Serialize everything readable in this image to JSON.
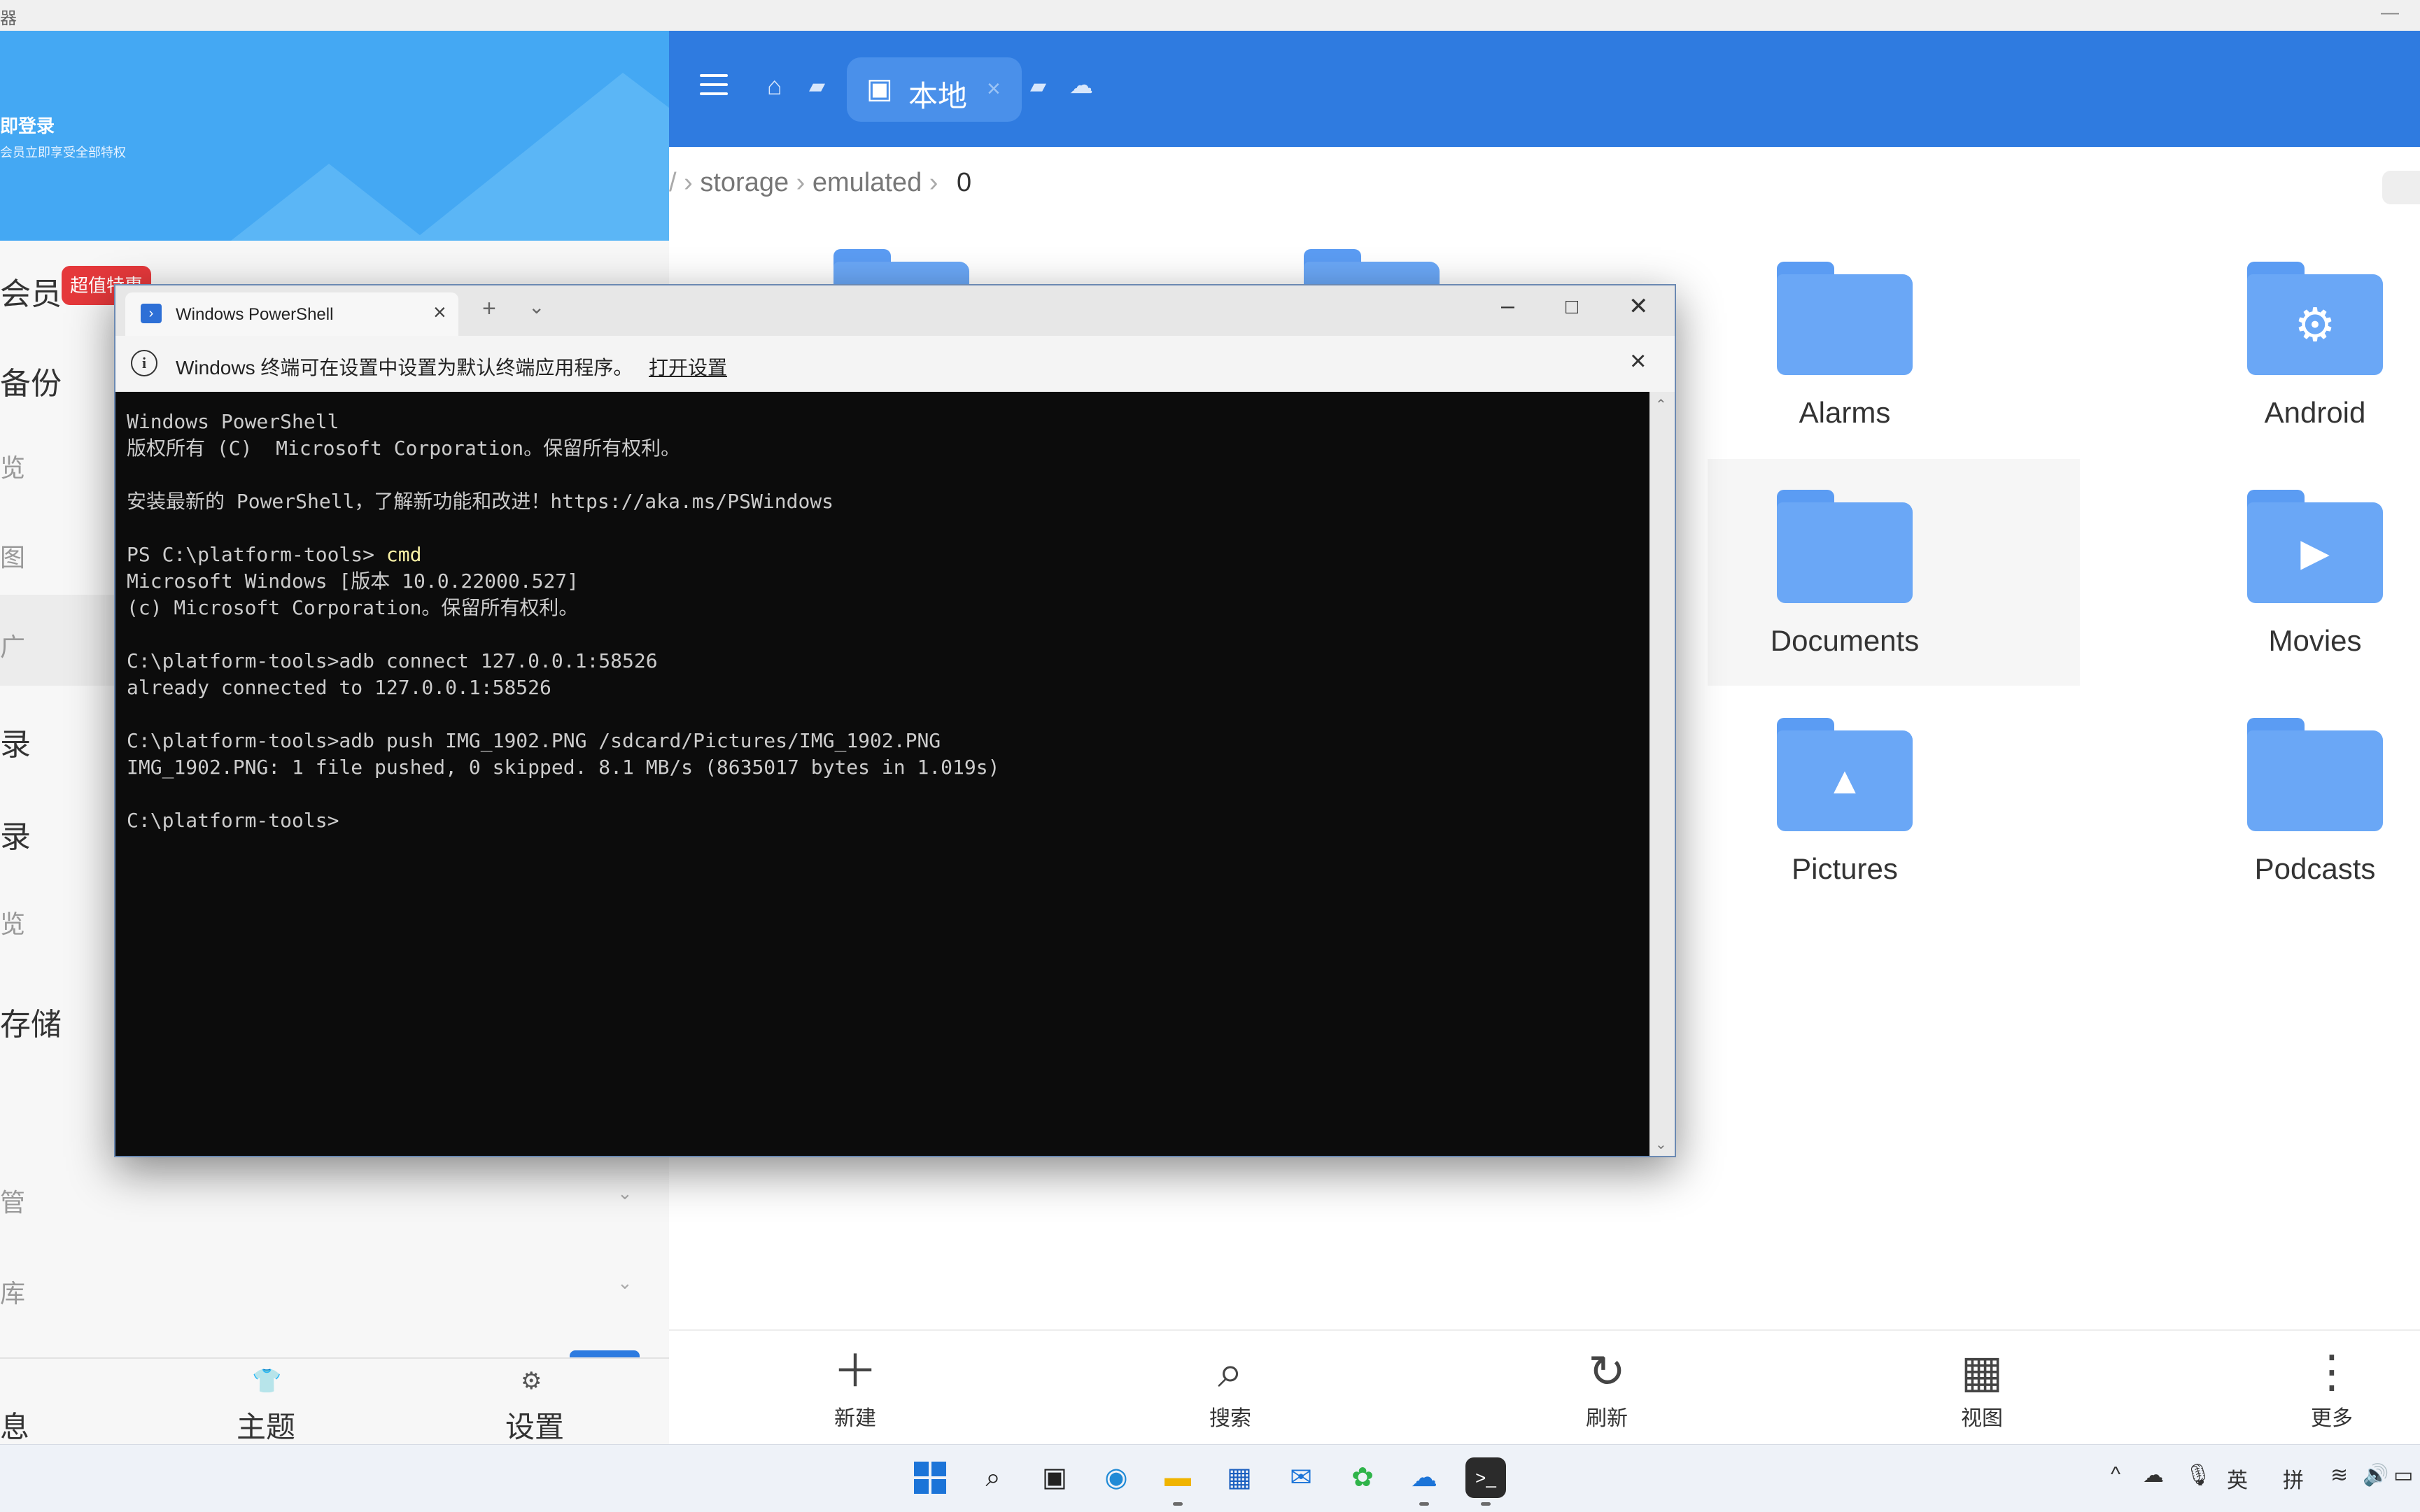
{
  "topbar": {
    "title": "器",
    "min": "—"
  },
  "drawer": {
    "login_title": "即登录",
    "login_sub": "会员立即享受全部特权",
    "items": [
      "会员",
      "备份",
      "览",
      "图",
      "广",
      "录",
      "录",
      "览",
      "存储",
      "管",
      "库"
    ],
    "vip_badge": "超值特惠",
    "bottom": {
      "msg": "息",
      "theme": "主题",
      "settings": "设置",
      "theme_icon": "shirt-icon",
      "settings_icon": "gear-icon"
    }
  },
  "appbar": {
    "tab_label": "本地",
    "tab_close": "×"
  },
  "breadcrumb": {
    "root": "/",
    "items": [
      "storage",
      "emulated",
      "0"
    ]
  },
  "folders": [
    {
      "name": "Alarms",
      "glyph": ""
    },
    {
      "name": "Android",
      "glyph": "⚙"
    },
    {
      "name": "Documents",
      "glyph": ""
    },
    {
      "name": "Movies",
      "glyph": "▶"
    },
    {
      "name": "Pictures",
      "glyph": "▲"
    },
    {
      "name": "Podcasts",
      "glyph": ""
    }
  ],
  "toolbar": [
    {
      "label": "新建",
      "icon": "plus-icon",
      "glyph": "＋"
    },
    {
      "label": "搜索",
      "icon": "search-icon",
      "glyph": "⌕"
    },
    {
      "label": "刷新",
      "icon": "refresh-icon",
      "glyph": "↻"
    },
    {
      "label": "视图",
      "icon": "grid-icon",
      "glyph": "▦"
    },
    {
      "label": "更多",
      "icon": "more-icon",
      "glyph": "⋮"
    }
  ],
  "powershell": {
    "tab_title": "Windows PowerShell",
    "info_msg": "Windows 终端可在设置中设置为默认终端应用程序。",
    "info_link": "打开设置",
    "lines": [
      "Windows PowerShell",
      "版权所有 (C)  Microsoft Corporation。保留所有权利。",
      "",
      "安装最新的 PowerShell，了解新功能和改进！https://aka.ms/PSWindows",
      "",
      "PS C:\\platform-tools> ",
      "Microsoft Windows [版本 10.0.22000.527]",
      "(c) Microsoft Corporation。保留所有权利。",
      "",
      "C:\\platform-tools>adb connect 127.0.0.1:58526",
      "already connected to 127.0.0.1:58526",
      "",
      "C:\\platform-tools>adb push IMG_1902.PNG /sdcard/Pictures/IMG_1902.PNG",
      "IMG_1902.PNG: 1 file pushed, 0 skipped. 8.1 MB/s (8635017 bytes in 1.019s)",
      "",
      "C:\\platform-tools>"
    ],
    "typed_cmd": "cmd"
  },
  "taskbar": {
    "tray": {
      "lang": "英",
      "ime": "拼"
    }
  }
}
